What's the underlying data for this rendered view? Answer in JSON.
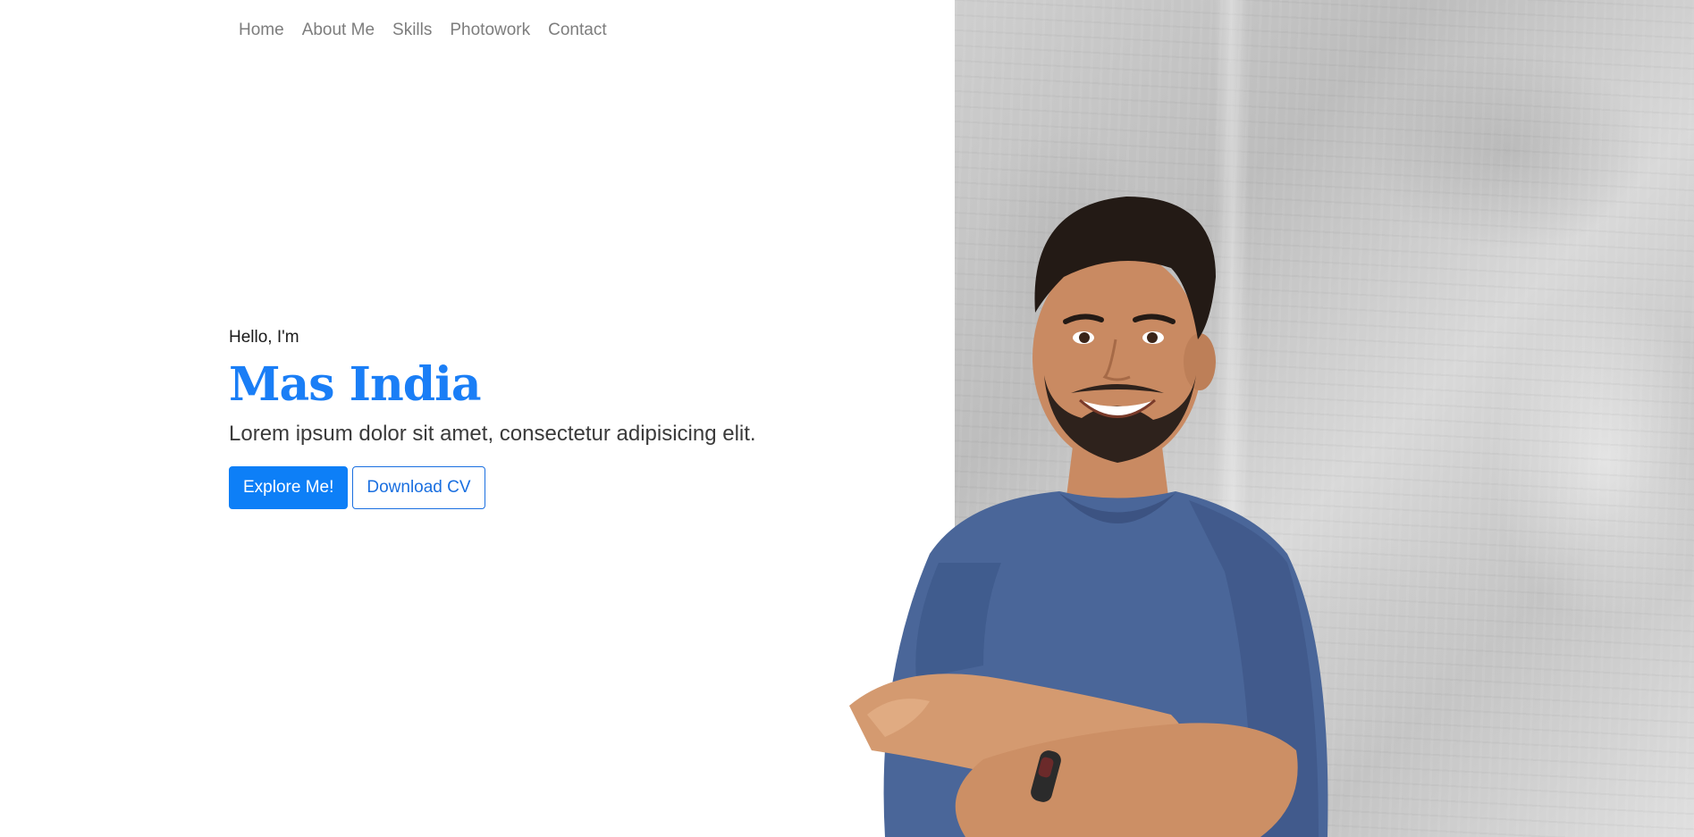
{
  "nav": {
    "items": [
      {
        "label": "Home"
      },
      {
        "label": "About Me"
      },
      {
        "label": "Skills"
      },
      {
        "label": "Photowork"
      },
      {
        "label": "Contact"
      }
    ]
  },
  "hero": {
    "greeting": "Hello, I'm",
    "name": "Mas India",
    "tagline": "Lorem ipsum dolor sit amet, consectetur adipisicing elit.",
    "primary_button": "Explore Me!",
    "secondary_button": "Download CV"
  },
  "colors": {
    "accent": "#0d7ff7",
    "name_text": "#1a7ef6",
    "nav_text": "#7d7d7d",
    "body_text": "#3a3a3a",
    "shirt": "#4a6699",
    "wall": "#cfcfcf"
  },
  "image": {
    "subject": "hero-portrait-photo"
  }
}
